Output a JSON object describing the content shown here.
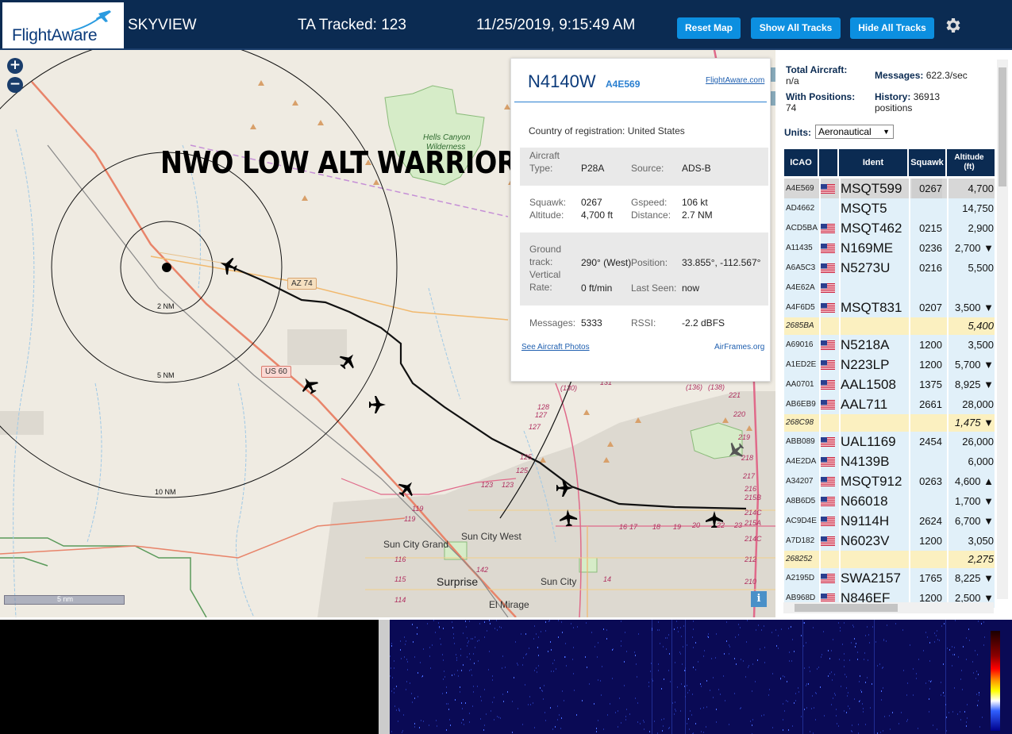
{
  "header": {
    "logo_text": "FlightAware",
    "app_title": "SKYVIEW",
    "ta_tracked": "TA Tracked: 123",
    "datetime": "11/25/2019, 9:15:49 AM",
    "btn_reset": "Reset Map",
    "btn_show": "Show All Tracks",
    "btn_hide": "Hide All Tracks",
    "settings_icon": "gear-icon"
  },
  "map": {
    "overlay_text": "NWO LOW ALT WARRIOR:",
    "zoom_in": "+",
    "zoom_out": "−",
    "scale_label": "5 nm",
    "info_label": "i",
    "ring_labels": {
      "r2": "2 NM",
      "r5": "5 NM",
      "r10": "10 NM"
    },
    "places": {
      "hells_canyon": "Hells Canyon",
      "wilderness": "Wilderness",
      "sun_city_grand": "Sun City Grand",
      "sun_city_west": "Sun City West",
      "surprise": "Surprise",
      "sun_city": "Sun City",
      "el_mirage": "El Mirage"
    },
    "shields": {
      "az74": "AZ 74",
      "us60": "US 60"
    },
    "road_numbers": {
      "n130": "(130)",
      "n131": "131",
      "n128": "128",
      "n127": "127",
      "n127b": "127",
      "n125": "125",
      "n125b": "125",
      "n123": "123",
      "n123b": "123",
      "n119": "119",
      "n119b": "119",
      "n116": "116",
      "n115": "115",
      "n114": "114",
      "n142": "142",
      "n14": "14",
      "n136": "(136)",
      "n138": "(138)",
      "n221": "221",
      "n220": "220",
      "n219": "219",
      "n218": "218",
      "n217": "217",
      "n216": "216",
      "n215b": "215B",
      "n214c": "214C",
      "n215a": "215A",
      "n214c2": "214C",
      "n212": "212",
      "n210": "210",
      "n17": "17",
      "n16": "16",
      "n18": "18",
      "n19": "19",
      "n20": "20",
      "n22": "22",
      "n23": "23"
    }
  },
  "popup": {
    "callsign": "N4140W",
    "icao": "A4E569",
    "fa_link": "FlightAware.com",
    "country_label": "Country of registration:",
    "country_value": "United States",
    "aircraft_type_label": "Aircraft\nType:",
    "aircraft_type_value": "P28A",
    "source_label": "Source:",
    "source_value": "ADS-B",
    "squawk_label": "Squawk:",
    "squawk_value": "0267",
    "gspeed_label": "Gspeed:",
    "gspeed_value": "106 kt",
    "altitude_label": "Altitude:",
    "altitude_value": "4,700 ft",
    "distance_label": "Distance:",
    "distance_value": "2.7 NM",
    "ground_track_label": "Ground\ntrack:",
    "ground_track_value": "290° (West)",
    "position_label": "Position:",
    "position_value": "33.855°, -112.567°",
    "vrate_label": "Vertical\nRate:",
    "vrate_value": "0 ft/min",
    "last_seen_label": "Last Seen:",
    "last_seen_value": "now",
    "messages_label": "Messages:",
    "messages_value": "5333",
    "rssi_label": "RSSI:",
    "rssi_value": "-2.2 dBFS",
    "photos_link": "See Aircraft Photos",
    "airframes_link": "AirFrames.org"
  },
  "panel": {
    "total_aircraft_label": "Total Aircraft:",
    "total_aircraft_value": "n/a",
    "messages_label": "Messages:",
    "messages_value": "622.3/sec",
    "with_positions_label": "With Positions:",
    "with_positions_value": "74",
    "history_label": "History:",
    "history_value": "36913",
    "history_unit": "positions",
    "units_label": "Units:",
    "units_value": "Aeronautical",
    "columns": {
      "icao": "ICAO",
      "ident": "Ident",
      "squawk": "Squawk",
      "altitude": "Altitude",
      "altitude_unit": "(ft)"
    }
  },
  "rows": [
    {
      "icao": "A4E569",
      "ident": "MSQT599",
      "squawk": "0267",
      "alt": "4,700",
      "type": "hl",
      "flag": true
    },
    {
      "icao": "AD4662",
      "ident": "MSQT5",
      "squawk": "",
      "alt": "14,750",
      "type": "",
      "flag": false
    },
    {
      "icao": "ACD5BA",
      "ident": "MSQT462",
      "squawk": "0215",
      "alt": "2,900",
      "type": "",
      "flag": true
    },
    {
      "icao": "A11435",
      "ident": "N169ME",
      "squawk": "0236",
      "alt": "2,700 ▼",
      "type": "",
      "flag": true
    },
    {
      "icao": "A6A5C3",
      "ident": "N5273U",
      "squawk": "0216",
      "alt": "5,500",
      "type": "",
      "flag": true
    },
    {
      "icao": "A4E62A",
      "ident": "",
      "squawk": "",
      "alt": "",
      "type": "",
      "flag": true
    },
    {
      "icao": "A4F6D5",
      "ident": "MSQT831",
      "squawk": "0207",
      "alt": "3,500 ▼",
      "type": "",
      "flag": true
    },
    {
      "icao": "2685BA",
      "ident": "",
      "squawk": "",
      "alt": "5,400",
      "type": "ylw",
      "flag": false
    },
    {
      "icao": "A69016",
      "ident": "N5218A",
      "squawk": "1200",
      "alt": "3,500",
      "type": "",
      "flag": true
    },
    {
      "icao": "A1ED2E",
      "ident": "N223LP",
      "squawk": "1200",
      "alt": "5,700 ▼",
      "type": "",
      "flag": true
    },
    {
      "icao": "AA0701",
      "ident": "AAL1508",
      "squawk": "1375",
      "alt": "8,925 ▼",
      "type": "",
      "flag": true
    },
    {
      "icao": "AB6EB9",
      "ident": "AAL711",
      "squawk": "2661",
      "alt": "28,000",
      "type": "",
      "flag": true
    },
    {
      "icao": "268C98",
      "ident": "",
      "squawk": "",
      "alt": "1,475 ▼",
      "type": "ylw",
      "flag": false
    },
    {
      "icao": "ABB089",
      "ident": "UAL1169",
      "squawk": "2454",
      "alt": "26,000",
      "type": "",
      "flag": true
    },
    {
      "icao": "A4E2DA",
      "ident": "N4139B",
      "squawk": "",
      "alt": "6,000",
      "type": "",
      "flag": true
    },
    {
      "icao": "A34207",
      "ident": "MSQT912",
      "squawk": "0263",
      "alt": "4,600 ▲",
      "type": "",
      "flag": true
    },
    {
      "icao": "A8B6D5",
      "ident": "N66018",
      "squawk": "",
      "alt": "1,700 ▼",
      "type": "",
      "flag": true
    },
    {
      "icao": "AC9D4E",
      "ident": "N9114H",
      "squawk": "2624",
      "alt": "6,700 ▼",
      "type": "",
      "flag": true
    },
    {
      "icao": "A7D182",
      "ident": "N6023V",
      "squawk": "1200",
      "alt": "3,050",
      "type": "",
      "flag": true
    },
    {
      "icao": "268252",
      "ident": "",
      "squawk": "",
      "alt": "2,275",
      "type": "ylw",
      "flag": false
    },
    {
      "icao": "A2195D",
      "ident": "SWA2157",
      "squawk": "1765",
      "alt": "8,225 ▼",
      "type": "",
      "flag": true
    },
    {
      "icao": "AB968D",
      "ident": "N846EF",
      "squawk": "1200",
      "alt": "2,500 ▼",
      "type": "",
      "flag": true
    }
  ]
}
